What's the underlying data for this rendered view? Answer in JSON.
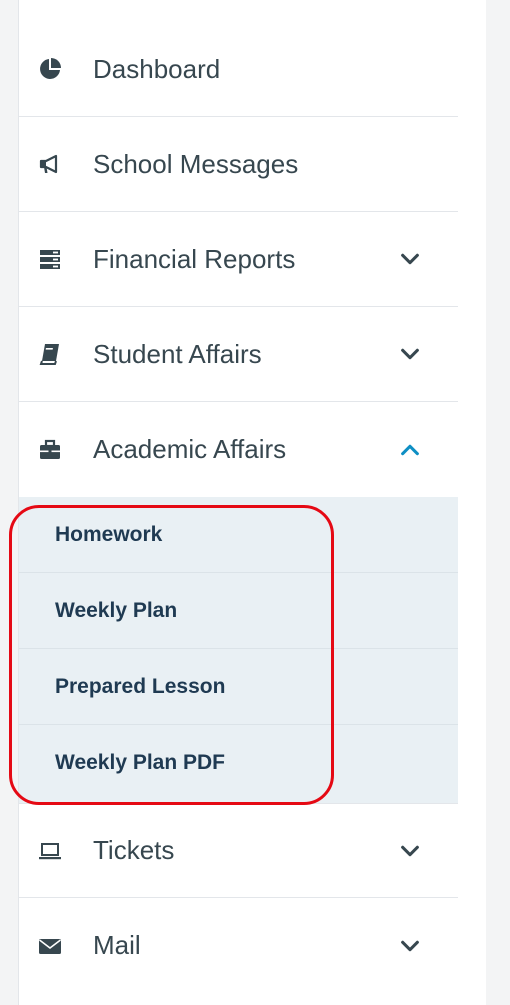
{
  "nav": {
    "items": [
      {
        "label": "Dashboard",
        "icon": "pie-chart-icon",
        "chevron": "none"
      },
      {
        "label": "School Messages",
        "icon": "megaphone-icon",
        "chevron": "none"
      },
      {
        "label": "Financial Reports",
        "icon": "server-icon",
        "chevron": "down"
      },
      {
        "label": "Student Affairs",
        "icon": "book-icon",
        "chevron": "down"
      },
      {
        "label": "Academic Affairs",
        "icon": "briefcase-icon",
        "chevron": "up"
      },
      {
        "label": "Tickets",
        "icon": "laptop-icon",
        "chevron": "down"
      },
      {
        "label": "Mail",
        "icon": "envelope-icon",
        "chevron": "down"
      }
    ],
    "academic_submenu": [
      {
        "label": "Homework"
      },
      {
        "label": "Weekly Plan"
      },
      {
        "label": "Prepared Lesson"
      },
      {
        "label": "Weekly Plan PDF"
      }
    ]
  },
  "colors": {
    "text": "#37474f",
    "submenu_text": "#1f3a52",
    "submenu_bg": "#e9f0f4",
    "accent": "#0e8fc4",
    "highlight": "#e50914"
  }
}
